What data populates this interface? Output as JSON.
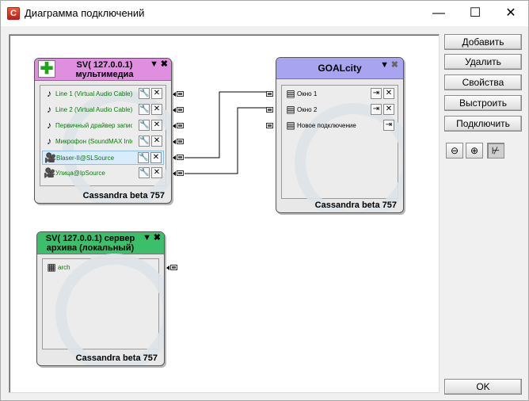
{
  "window": {
    "title": "Диаграмма подключений",
    "minimize": "—",
    "maximize": "☐",
    "close": "✕"
  },
  "buttons": {
    "add": "Добавить",
    "delete": "Удалить",
    "properties": "Свойства",
    "arrange": "Выстроить",
    "connect": "Подключить",
    "ok": "OK"
  },
  "tools": {
    "zoom_out": "⊖",
    "zoom_in": "⊕",
    "select": "⊬"
  },
  "node_multimedia": {
    "title_line1": "SV( 127.0.0.1)",
    "title_line2": "мультимедиа",
    "header_color": "#e08ee0",
    "footer": "Cassandra beta 757",
    "rows": [
      {
        "label": "Line 1 (Virtual Audio Cable)"
      },
      {
        "label": "Line 2 (Virtual Audio Cable)"
      },
      {
        "label": "Первичный драйвер записи"
      },
      {
        "label": "Микрофон (SoundMAX Integrated)"
      },
      {
        "label": "Blaser-II@SLSource"
      },
      {
        "label": "Улица@IpSource"
      }
    ]
  },
  "node_goal": {
    "title": "GOALcity",
    "header_color": "#a8a4f0",
    "footer": "Cassandra beta 757",
    "rows": [
      {
        "label": "Окно 1"
      },
      {
        "label": "Окно 2"
      },
      {
        "label": "Новое подключение"
      }
    ]
  },
  "node_archive": {
    "title_line1": "SV( 127.0.0.1) сервер",
    "title_line2": "архива (локальный)",
    "header_color": "#3cbf6a",
    "footer": "Cassandra beta 757",
    "rows": [
      {
        "label": "arch"
      }
    ]
  },
  "colors": {
    "wire": "#000000",
    "row_text_green": "#0a7a0a",
    "row_selected_bg": "#d8ecfc"
  }
}
